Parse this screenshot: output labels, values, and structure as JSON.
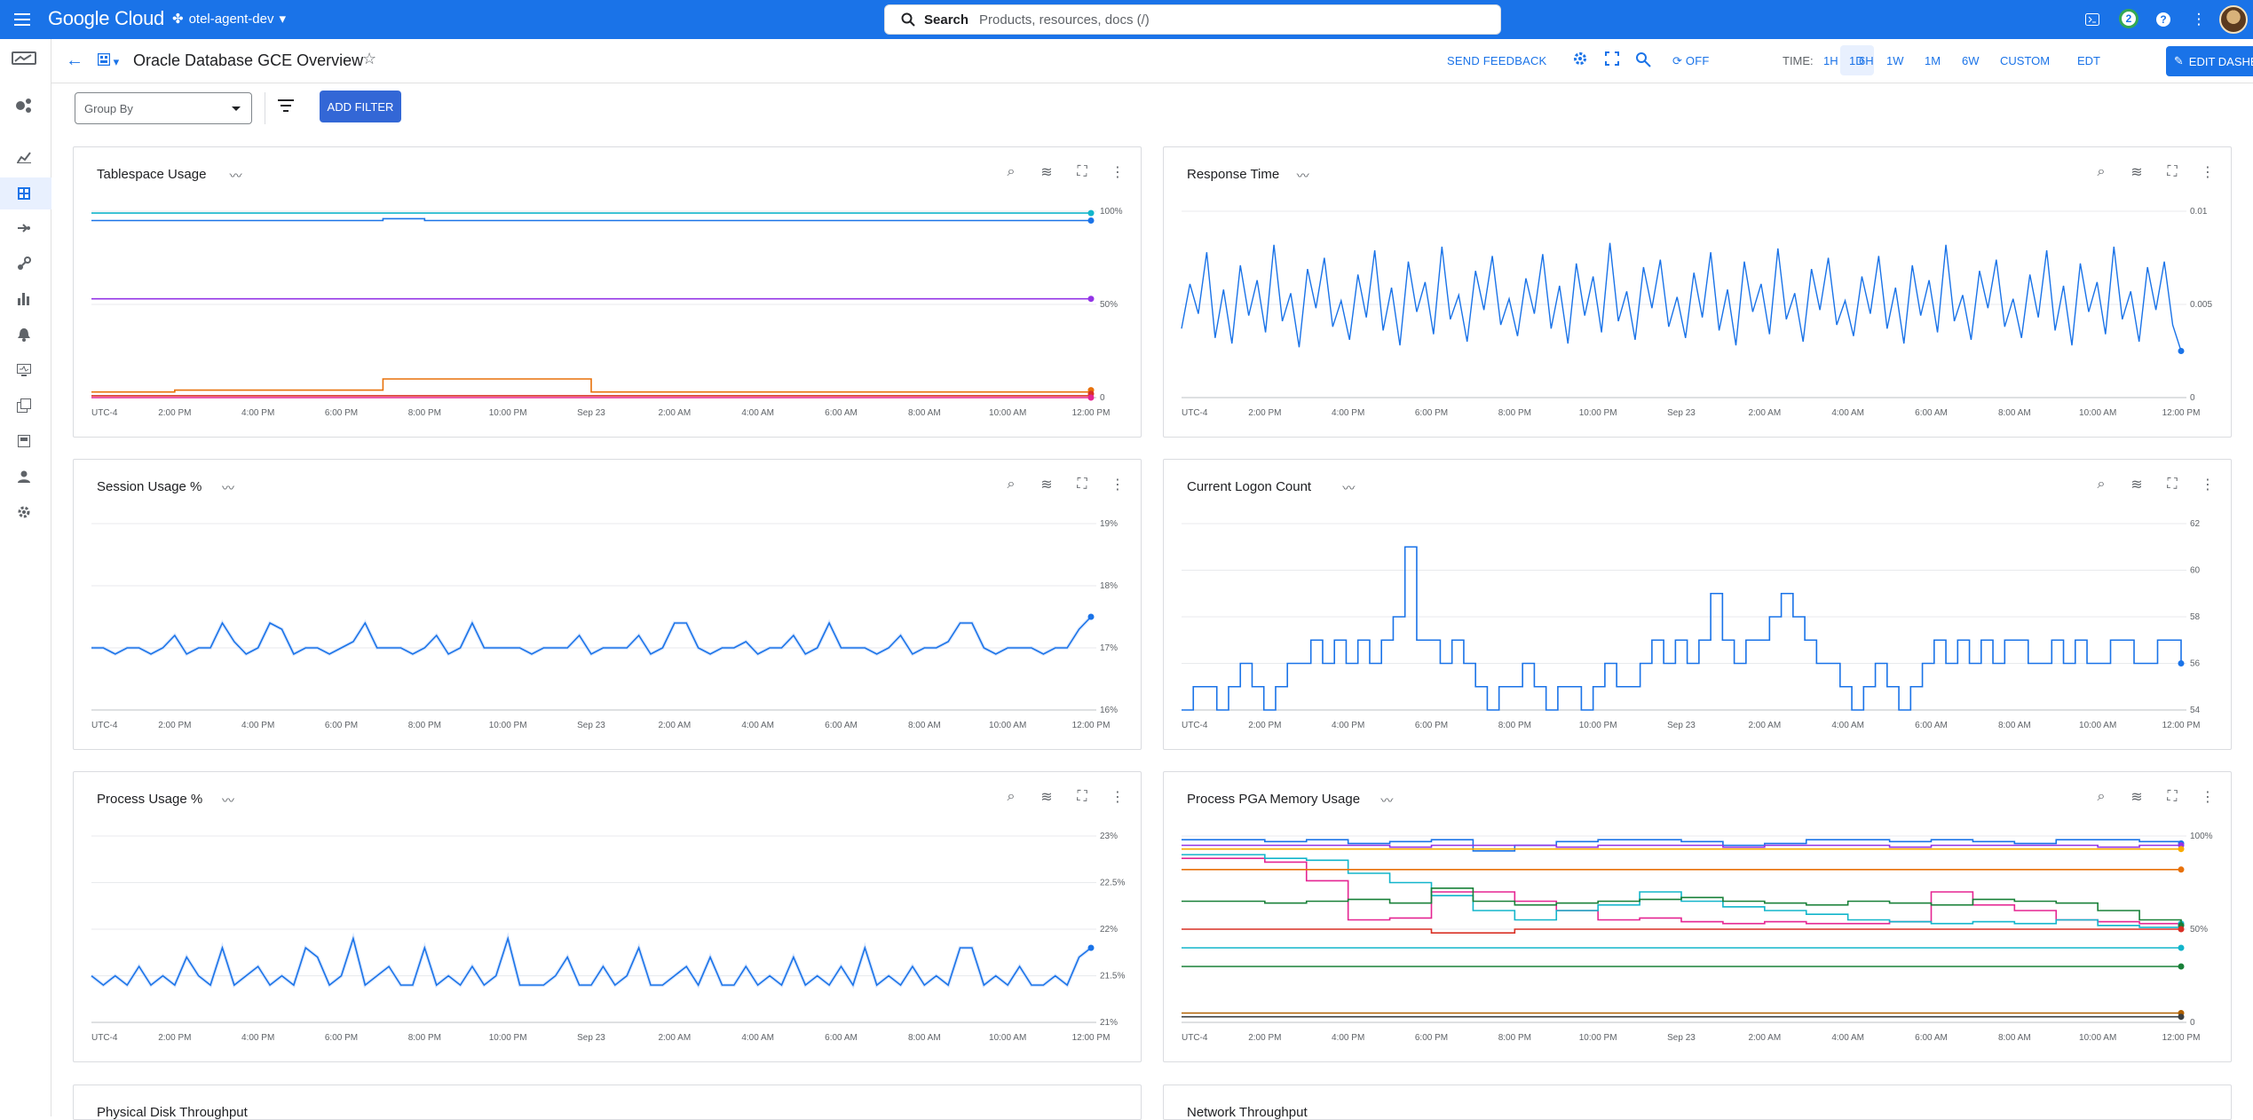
{
  "topbar": {
    "logo": "Google Cloud",
    "project": "otel-agent-dev",
    "search_label": "Search",
    "search_placeholder": "Products, resources, docs (/)",
    "notifications_count": "2",
    "icons": [
      "menu-icon",
      "cloud-shell-icon",
      "help-icon",
      "more-vert-icon"
    ]
  },
  "header": {
    "title": "Oracle Database GCE Overview",
    "send_feedback": "SEND FEEDBACK",
    "refresh_state": "OFF",
    "time_label": "TIME:",
    "time_options": [
      "1H",
      "6H",
      "1D",
      "1W",
      "1M",
      "6W",
      "CUSTOM"
    ],
    "selected_time": "1D",
    "timezone": "EDT",
    "edit_dashboard": "EDIT DASHBOARD"
  },
  "filters": {
    "group_by_placeholder": "Group By",
    "add_filter": "ADD FILTER"
  },
  "x_ticks": [
    "UTC-4",
    "2:00 PM",
    "4:00 PM",
    "6:00 PM",
    "8:00 PM",
    "10:00 PM",
    "Sep 23",
    "2:00 AM",
    "4:00 AM",
    "6:00 AM",
    "8:00 AM",
    "10:00 AM",
    "12:00 PM"
  ],
  "chart_data": [
    {
      "id": "tablespace",
      "title": "Tablespace Usage",
      "type": "line",
      "y_ticks": [
        "100%",
        "50%",
        "0"
      ],
      "ylim": [
        0,
        100
      ],
      "series": [
        {
          "color": "#12b5cb",
          "values": [
            99,
            99,
            99,
            99,
            99,
            99,
            99,
            99,
            99,
            99,
            99,
            99,
            99,
            99,
            99,
            99,
            99,
            99,
            99,
            99,
            99,
            99,
            99,
            99,
            99
          ]
        },
        {
          "color": "#1a73e8",
          "values": [
            95,
            95,
            95,
            95,
            95,
            95,
            95,
            96,
            95,
            95,
            95,
            95,
            95,
            95,
            95,
            95,
            95,
            95,
            95,
            95,
            95,
            95,
            95,
            95,
            95
          ]
        },
        {
          "color": "#9334e6",
          "values": [
            53,
            53,
            53,
            53,
            53,
            53,
            53,
            53,
            53,
            53,
            53,
            53,
            53,
            53,
            53,
            53,
            53,
            53,
            53,
            53,
            53,
            53,
            53,
            53,
            53
          ]
        },
        {
          "color": "#e8710a",
          "values": [
            3,
            3,
            4,
            4,
            4,
            4,
            4,
            10,
            10,
            10,
            10,
            10,
            3,
            3,
            3,
            3,
            3,
            3,
            3,
            3,
            3,
            3,
            3,
            3,
            4
          ]
        },
        {
          "color": "#d93025",
          "values": [
            1,
            1,
            1,
            1,
            1,
            1,
            1,
            1,
            1,
            1,
            1,
            1,
            1,
            1,
            1,
            1,
            1,
            1,
            1,
            1,
            1,
            1,
            1,
            1,
            2
          ]
        },
        {
          "color": "#e52592",
          "values": [
            0,
            0,
            0,
            0,
            0,
            0,
            0,
            0,
            0,
            0,
            0,
            0,
            0,
            0,
            0,
            0,
            0,
            0,
            0,
            0,
            0,
            0,
            0,
            0,
            0
          ]
        }
      ]
    },
    {
      "id": "response",
      "title": "Response Time",
      "type": "line",
      "y_ticks": [
        "0.01",
        "0.005",
        "0"
      ],
      "ylim": [
        0,
        0.01
      ],
      "series": [
        {
          "color": "#1a73e8",
          "values": [
            0.0037,
            0.0061,
            0.0045,
            0.0078,
            0.0032,
            0.0058,
            0.0029,
            0.0071,
            0.0044,
            0.0063,
            0.0035,
            0.0082,
            0.0041,
            0.0056,
            0.0027,
            0.0069,
            0.0048,
            0.0075,
            0.0038,
            0.0052,
            0.0031,
            0.0066,
            0.0043,
            0.0079,
            0.0036,
            0.0059,
            0.0028,
            0.0073,
            0.0046,
            0.0062,
            0.0034,
            0.0081,
            0.0042,
            0.0055,
            0.003,
            0.0068,
            0.0047,
            0.0076,
            0.0039,
            0.0053,
            0.0033,
            0.0064,
            0.0045,
            0.0077,
            0.0037,
            0.006,
            0.0029,
            0.0072,
            0.0044,
            0.0065,
            0.0035,
            0.0083,
            0.0041,
            0.0057,
            0.0031,
            0.007,
            0.0048,
            0.0074,
            0.0038,
            0.0054,
            0.0032,
            0.0067,
            0.0043,
            0.0078,
            0.0036,
            0.0058,
            0.0028,
            0.0073,
            0.0046,
            0.0061,
            0.0034,
            0.008,
            0.0042,
            0.0056,
            0.003,
            0.0069,
            0.0047,
            0.0075,
            0.0039,
            0.0052,
            0.0033,
            0.0065,
            0.0045,
            0.0076,
            0.0037,
            0.0059,
            0.0029,
            0.0071,
            0.0044,
            0.0063,
            0.0035,
            0.0082,
            0.0041,
            0.0055,
            0.0031,
            0.0068,
            0.0048,
            0.0074,
            0.0038,
            0.0053,
            0.0032,
            0.0066,
            0.0043,
            0.0079,
            0.0036,
            0.006,
            0.0028,
            0.0072,
            0.0046,
            0.0062,
            0.0034,
            0.0081,
            0.0042,
            0.0057,
            0.003,
            0.007,
            0.0047,
            0.0073,
            0.0039,
            0.0025
          ]
        }
      ]
    },
    {
      "id": "session",
      "title": "Session Usage %",
      "type": "line",
      "y_ticks": [
        "19%",
        "18%",
        "17%",
        "16%"
      ],
      "ylim": [
        16,
        19
      ],
      "series": [
        {
          "color": "#1a73e8",
          "values": [
            17,
            17,
            16.9,
            17,
            17,
            16.9,
            17,
            17.2,
            16.9,
            17,
            17,
            17.4,
            17.1,
            16.9,
            17,
            17.4,
            17.3,
            16.9,
            17,
            17,
            16.9,
            17,
            17.1,
            17.4,
            17,
            17,
            17,
            16.9,
            17,
            17.2,
            16.9,
            17,
            17.4,
            17,
            17,
            17,
            17,
            16.9,
            17,
            17,
            17,
            17.2,
            16.9,
            17,
            17,
            17,
            17.2,
            16.9,
            17,
            17.4,
            17.4,
            17,
            16.9,
            17,
            17,
            17.1,
            16.9,
            17,
            17,
            17.2,
            16.9,
            17,
            17.4,
            17,
            17,
            17,
            16.9,
            17,
            17.2,
            16.9,
            17,
            17,
            17.1,
            17.4,
            17.4,
            17,
            16.9,
            17,
            17,
            17,
            16.9,
            17,
            17,
            17.3,
            17.5
          ]
        }
      ]
    },
    {
      "id": "logon",
      "title": "Current Logon Count",
      "type": "line",
      "y_ticks": [
        "62",
        "60",
        "58",
        "56",
        "54"
      ],
      "ylim": [
        54,
        62
      ],
      "series": [
        {
          "color": "#1a73e8",
          "values": [
            54,
            55,
            55,
            54,
            55,
            56,
            55,
            54,
            55,
            56,
            56,
            57,
            56,
            57,
            56,
            57,
            56,
            57,
            58,
            61,
            57,
            57,
            56,
            57,
            56,
            55,
            54,
            55,
            55,
            56,
            55,
            54,
            55,
            55,
            54,
            55,
            56,
            55,
            55,
            56,
            57,
            56,
            57,
            56,
            57,
            59,
            57,
            56,
            57,
            57,
            58,
            59,
            58,
            57,
            56,
            56,
            55,
            54,
            55,
            56,
            55,
            54,
            55,
            56,
            57,
            56,
            57,
            56,
            57,
            56,
            57,
            57,
            56,
            56,
            57,
            56,
            57,
            56,
            56,
            57,
            57,
            56,
            56,
            57,
            57,
            56
          ]
        }
      ]
    },
    {
      "id": "process",
      "title": "Process Usage %",
      "type": "line",
      "y_ticks": [
        "23%",
        "22.5%",
        "22%",
        "21.5%",
        "21%"
      ],
      "ylim": [
        21,
        23
      ],
      "series": [
        {
          "color": "#1a73e8",
          "values": [
            21.5,
            21.4,
            21.5,
            21.4,
            21.6,
            21.4,
            21.5,
            21.4,
            21.7,
            21.5,
            21.4,
            21.8,
            21.4,
            21.5,
            21.6,
            21.4,
            21.5,
            21.4,
            21.8,
            21.7,
            21.4,
            21.5,
            21.9,
            21.4,
            21.5,
            21.6,
            21.4,
            21.4,
            21.8,
            21.4,
            21.5,
            21.4,
            21.6,
            21.4,
            21.5,
            21.9,
            21.4,
            21.4,
            21.4,
            21.5,
            21.7,
            21.4,
            21.4,
            21.6,
            21.4,
            21.5,
            21.8,
            21.4,
            21.4,
            21.5,
            21.6,
            21.4,
            21.7,
            21.4,
            21.4,
            21.6,
            21.4,
            21.5,
            21.4,
            21.7,
            21.4,
            21.5,
            21.4,
            21.6,
            21.4,
            21.8,
            21.4,
            21.5,
            21.4,
            21.6,
            21.4,
            21.5,
            21.4,
            21.8,
            21.8,
            21.4,
            21.5,
            21.4,
            21.6,
            21.4,
            21.4,
            21.5,
            21.4,
            21.7,
            21.8
          ]
        }
      ]
    },
    {
      "id": "pga",
      "title": "Process PGA Memory Usage",
      "type": "line",
      "y_ticks": [
        "100%",
        "50%",
        "0"
      ],
      "ylim": [
        0,
        100
      ],
      "series": [
        {
          "color": "#1a73e8",
          "values": [
            98,
            98,
            97,
            98,
            96,
            97,
            98,
            92,
            95,
            97,
            98,
            98,
            97,
            95,
            96,
            98,
            98,
            97,
            98,
            97,
            96,
            98,
            98,
            97,
            96
          ]
        },
        {
          "color": "#9334e6",
          "values": [
            95,
            95,
            95,
            95,
            95,
            94,
            95,
            95,
            95,
            94,
            95,
            95,
            95,
            94,
            95,
            95,
            95,
            94,
            95,
            95,
            95,
            95,
            94,
            95,
            95
          ]
        },
        {
          "color": "#e52592",
          "values": [
            88,
            88,
            86,
            76,
            55,
            56,
            70,
            70,
            65,
            60,
            55,
            56,
            54,
            53,
            54,
            53,
            53,
            54,
            70,
            63,
            60,
            55,
            54,
            53,
            52
          ]
        },
        {
          "color": "#12b5cb",
          "values": [
            90,
            90,
            88,
            87,
            80,
            75,
            68,
            60,
            55,
            60,
            63,
            70,
            65,
            62,
            60,
            58,
            55,
            54,
            53,
            54,
            53,
            55,
            52,
            51,
            53
          ]
        },
        {
          "color": "#188038",
          "values": [
            65,
            65,
            64,
            65,
            66,
            64,
            72,
            65,
            63,
            64,
            65,
            66,
            67,
            65,
            64,
            63,
            65,
            64,
            63,
            66,
            65,
            64,
            60,
            55,
            52
          ]
        },
        {
          "color": "#d93025",
          "values": [
            50,
            50,
            50,
            50,
            50,
            50,
            48,
            48,
            50,
            50,
            50,
            50,
            50,
            50,
            50,
            50,
            50,
            50,
            50,
            50,
            50,
            50,
            50,
            50,
            50
          ]
        },
        {
          "color": "#e8710a",
          "values": [
            82,
            82,
            82,
            82,
            82,
            82,
            82,
            82,
            82,
            82,
            82,
            82,
            82,
            82,
            82,
            82,
            82,
            82,
            82,
            82,
            82,
            82,
            82,
            82,
            82
          ]
        },
        {
          "color": "#f9ab00",
          "values": [
            93,
            93,
            93,
            93,
            93,
            93,
            93,
            93,
            93,
            93,
            93,
            93,
            93,
            93,
            93,
            93,
            93,
            93,
            93,
            93,
            93,
            93,
            93,
            93,
            93
          ]
        },
        {
          "color": "#188038",
          "values": [
            30,
            30,
            30,
            30,
            30,
            30,
            30,
            30,
            30,
            30,
            30,
            30,
            30,
            30,
            30,
            30,
            30,
            30,
            30,
            30,
            30,
            30,
            30,
            30,
            30
          ]
        },
        {
          "color": "#12b5cb",
          "values": [
            40,
            40,
            40,
            40,
            40,
            40,
            40,
            40,
            40,
            40,
            40,
            40,
            40,
            40,
            40,
            40,
            40,
            40,
            40,
            40,
            40,
            40,
            40,
            40,
            40
          ]
        },
        {
          "color": "#b06000",
          "values": [
            5,
            5,
            5,
            5,
            5,
            5,
            5,
            5,
            5,
            5,
            5,
            5,
            5,
            5,
            5,
            5,
            5,
            5,
            5,
            5,
            5,
            5,
            5,
            5,
            5
          ]
        },
        {
          "color": "#3c4043",
          "values": [
            3,
            3,
            3,
            3,
            3,
            3,
            3,
            3,
            3,
            3,
            3,
            3,
            3,
            3,
            3,
            3,
            3,
            3,
            3,
            3,
            3,
            3,
            3,
            3,
            3
          ]
        }
      ]
    }
  ],
  "bottom_cards": [
    "Physical Disk Throughput",
    "Network Throughput"
  ]
}
